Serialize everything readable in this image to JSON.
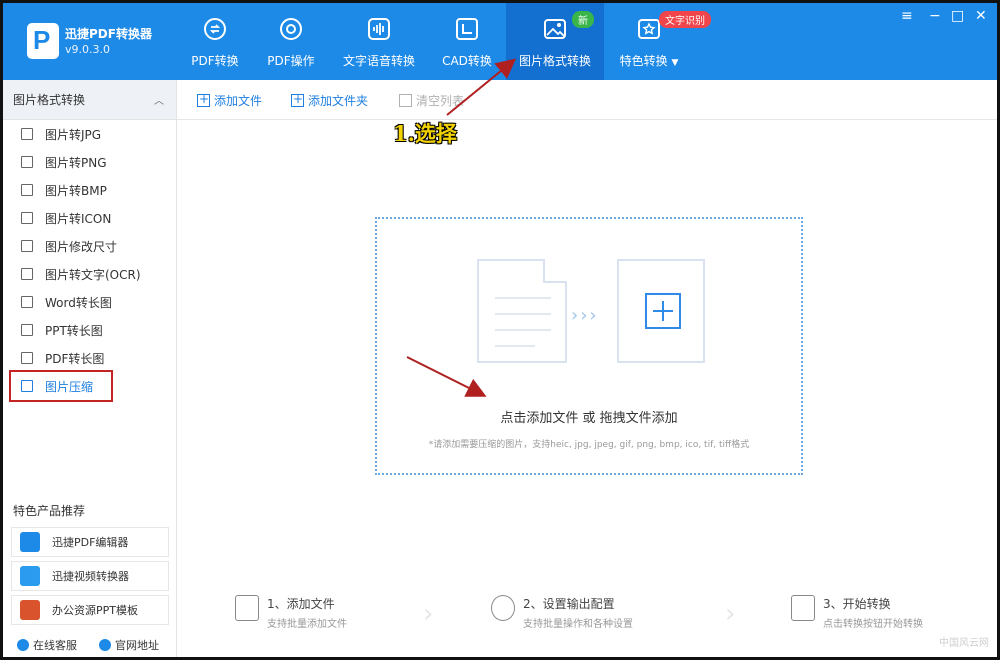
{
  "app": {
    "name": "迅捷PDF转换器",
    "version": "v9.0.3.0",
    "brand_color": "#1e8ae8",
    "active_tab_color": "#136fd0"
  },
  "nav": {
    "tabs": [
      {
        "label": "PDF转换",
        "icon": "pdf-convert-icon"
      },
      {
        "label": "PDF操作",
        "icon": "pdf-operate-icon"
      },
      {
        "label": "文字语音转换",
        "icon": "audio-wave-icon"
      },
      {
        "label": "CAD转换",
        "icon": "cad-icon"
      },
      {
        "label": "图片格式转换",
        "icon": "image-icon",
        "badge": "新"
      },
      {
        "label": "特色转换",
        "icon": "feature-icon",
        "badge": "文字识别"
      }
    ],
    "window_controls": [
      "≡",
      "−",
      "□",
      "✕"
    ]
  },
  "sidebar": {
    "header": "图片格式转换",
    "items": [
      {
        "label": "图片转JPG"
      },
      {
        "label": "图片转PNG"
      },
      {
        "label": "图片转BMP"
      },
      {
        "label": "图片转ICON"
      },
      {
        "label": "图片修改尺寸"
      },
      {
        "label": "图片转文字(OCR)"
      },
      {
        "label": "Word转长图"
      },
      {
        "label": "PPT转长图"
      },
      {
        "label": "PDF转长图"
      },
      {
        "label": "图片压缩"
      }
    ],
    "promo_title": "特色产品推荐",
    "promos": [
      {
        "label": "迅捷PDF编辑器"
      },
      {
        "label": "迅捷视频转换器"
      },
      {
        "label": "办公资源PPT模板"
      }
    ],
    "footer": {
      "service": "在线客服",
      "website": "官网地址"
    }
  },
  "toolbar": {
    "add_file": "添加文件",
    "add_folder": "添加文件夹",
    "clear_list": "清空列表"
  },
  "dropzone": {
    "main_text": "点击添加文件 或 拖拽文件添加",
    "hint": "*请添加需要压缩的图片，支持heic, jpg, jpeg, gif, png, bmp, ico, tif, tiff格式"
  },
  "steps": [
    {
      "title": "1、添加文件",
      "desc": "支持批量添加文件"
    },
    {
      "title": "2、设置输出配置",
      "desc": "支持批量操作和各种设置"
    },
    {
      "title": "3、开始转换",
      "desc": "点击转换按钮开始转换"
    }
  ],
  "annotation": {
    "label": "1.选择",
    "arrow_color": "#b02020"
  },
  "watermark": "中国风云网"
}
